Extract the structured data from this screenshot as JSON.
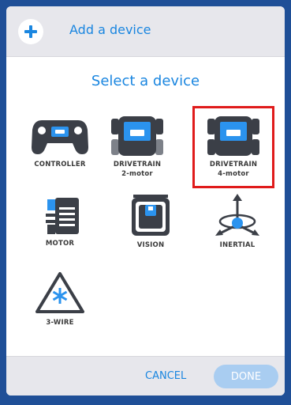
{
  "header": {
    "title": "Add a device",
    "add_icon": "plus-icon"
  },
  "main": {
    "title": "Select a device"
  },
  "devices": [
    {
      "label": "CONTROLLER",
      "sublabel": "",
      "icon": "controller-icon"
    },
    {
      "label": "DRIVETRAIN",
      "sublabel": "2-motor",
      "icon": "drivetrain-2-motor-icon"
    },
    {
      "label": "DRIVETRAIN",
      "sublabel": "4-motor",
      "icon": "drivetrain-4-motor-icon",
      "selected": true
    },
    {
      "label": "MOTOR",
      "sublabel": "",
      "icon": "motor-icon"
    },
    {
      "label": "VISION",
      "sublabel": "",
      "icon": "vision-sensor-icon"
    },
    {
      "label": "INERTIAL",
      "sublabel": "",
      "icon": "inertial-sensor-icon"
    },
    {
      "label": "3-WIRE",
      "sublabel": "",
      "icon": "three-wire-icon"
    }
  ],
  "footer": {
    "cancel_label": "CANCEL",
    "done_label": "DONE"
  },
  "colors": {
    "accent": "#1a86e0",
    "background": "#1f4f97",
    "selection": "#e01b1b",
    "icon_dark": "#3b3f47",
    "icon_blue": "#2b93ee"
  }
}
